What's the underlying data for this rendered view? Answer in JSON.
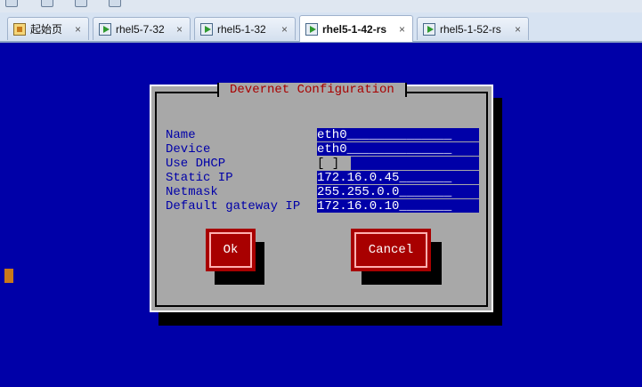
{
  "tabs": [
    {
      "label": "起始页",
      "icon": "home-icon",
      "active": false
    },
    {
      "label": "rhel5-7-32",
      "icon": "vm-icon",
      "active": false
    },
    {
      "label": "rhel5-1-32",
      "icon": "vm-icon",
      "active": false
    },
    {
      "label": "rhel5-1-42-rs",
      "icon": "vm-icon",
      "active": true
    },
    {
      "label": "rhel5-1-52-rs",
      "icon": "vm-icon",
      "active": false
    }
  ],
  "tab_close_glyph": "×",
  "dialog": {
    "title": "Devernet Configuration",
    "fields": [
      {
        "label": "Name",
        "value": "eth0",
        "filler": "______________"
      },
      {
        "label": "Device",
        "value": "eth0",
        "filler": "______________"
      },
      {
        "label": "Use DHCP",
        "checkbox": "[ ]"
      },
      {
        "label": "Static IP",
        "value": "172.16.0.45",
        "filler": "_______"
      },
      {
        "label": "Netmask",
        "value": "255.255.0.0",
        "filler": "_______"
      },
      {
        "label": "Default gateway IP",
        "value": "172.16.0.10",
        "filler": "_______"
      }
    ],
    "ok_label": "Ok",
    "cancel_label": "Cancel"
  },
  "colors": {
    "terminal_bg": "#0000a8",
    "dialog_bg": "#a8a8a8",
    "title_color": "#a80000",
    "label_color": "#0000a8",
    "button_bg": "#a80000"
  }
}
